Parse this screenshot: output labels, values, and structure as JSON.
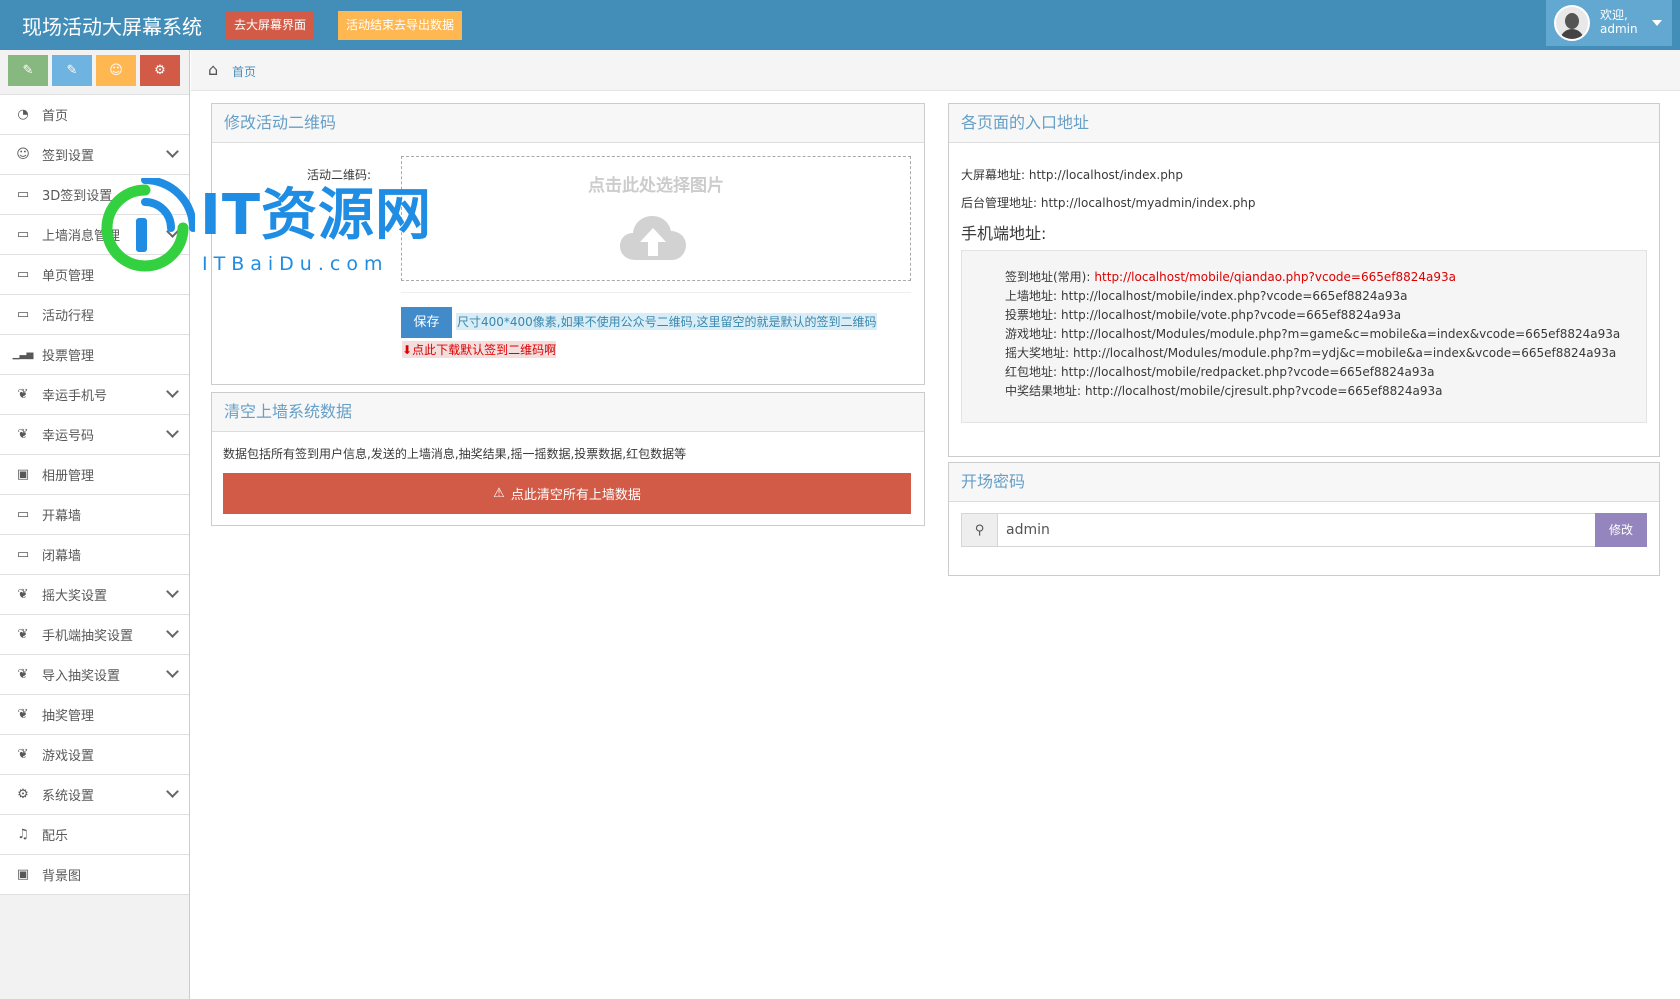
{
  "navbar": {
    "brand": "现场活动大屏幕系统",
    "btn_big_screen": "去大屏幕界面",
    "btn_export": "活动结束去导出数据",
    "welcome": "欢迎,",
    "username": "admin"
  },
  "colors": {
    "navbar": "#438eb9",
    "shortcut_green": "#87b87f",
    "shortcut_blue": "#6fb3e0",
    "shortcut_orange": "#ffb752",
    "shortcut_red": "#d15b47",
    "danger": "#d15b47",
    "primary": "#428bca",
    "purple": "#9585bf",
    "link_red": "#dd0000"
  },
  "sidebar": {
    "items": [
      {
        "label": "首页",
        "icon": "dashboard-icon",
        "has_submenu": false
      },
      {
        "label": "签到设置",
        "icon": "users-icon",
        "has_submenu": true
      },
      {
        "label": "3D签到设置",
        "icon": "desktop-icon",
        "has_submenu": false
      },
      {
        "label": "上墙消息管理",
        "icon": "desktop-icon",
        "has_submenu": true
      },
      {
        "label": "单页管理",
        "icon": "desktop-icon",
        "has_submenu": false
      },
      {
        "label": "活动行程",
        "icon": "desktop-icon",
        "has_submenu": false
      },
      {
        "label": "投票管理",
        "icon": "signal-icon",
        "has_submenu": false
      },
      {
        "label": "幸运手机号",
        "icon": "gift-icon",
        "has_submenu": true
      },
      {
        "label": "幸运号码",
        "icon": "gift-icon",
        "has_submenu": true
      },
      {
        "label": "相册管理",
        "icon": "picture-icon",
        "has_submenu": false
      },
      {
        "label": "开幕墙",
        "icon": "desktop-icon",
        "has_submenu": false
      },
      {
        "label": "闭幕墙",
        "icon": "desktop-icon",
        "has_submenu": false
      },
      {
        "label": "摇大奖设置",
        "icon": "gift-icon",
        "has_submenu": true
      },
      {
        "label": "手机端抽奖设置",
        "icon": "gift-icon",
        "has_submenu": true
      },
      {
        "label": "导入抽奖设置",
        "icon": "gift-icon",
        "has_submenu": true
      },
      {
        "label": "抽奖管理",
        "icon": "gift-icon",
        "has_submenu": false
      },
      {
        "label": "游戏设置",
        "icon": "gift-icon",
        "has_submenu": false
      },
      {
        "label": "系统设置",
        "icon": "cog-icon",
        "has_submenu": true
      },
      {
        "label": "配乐",
        "icon": "music-icon",
        "has_submenu": false
      },
      {
        "label": "背景图",
        "icon": "picture-icon",
        "has_submenu": false
      }
    ]
  },
  "breadcrumb": {
    "home": "首页"
  },
  "qrcode_widget": {
    "title": "修改活动二维码",
    "field_label": "活动二维码:",
    "dropzone_text": "点击此处选择图片",
    "save": "保存",
    "hint": "尺寸400*400像素,如果不使用公众号二维码,这里留空的就是默认的签到二维码",
    "download": "点此下载默认签到二维码啊"
  },
  "clear_widget": {
    "title": "清空上墙系统数据",
    "desc": "数据包括所有签到用户信息,发送的上墙消息,抽奖结果,摇一摇数据,投票数据,红包数据等",
    "button": "点此清空所有上墙数据"
  },
  "entry_widget": {
    "title": "各页面的入口地址",
    "big_screen_label": "大屏幕地址:",
    "big_screen_url": "http://localhost/index.php",
    "admin_label": "后台管理地址:",
    "admin_url": "http://localhost/myadmin/index.php",
    "mobile_heading": "手机端地址:",
    "mobile": [
      {
        "label": "签到地址(常用):",
        "url": "http://localhost/mobile/qiandao.php?vcode=665ef8824a93a"
      },
      {
        "label": "上墙地址:",
        "url": "http://localhost/mobile/index.php?vcode=665ef8824a93a"
      },
      {
        "label": "投票地址:",
        "url": "http://localhost/mobile/vote.php?vcode=665ef8824a93a"
      },
      {
        "label": "游戏地址:",
        "url": "http://localhost/Modules/module.php?m=game&c=mobile&a=index&vcode=665ef8824a93a"
      },
      {
        "label": "摇大奖地址:",
        "url": "http://localhost/Modules/module.php?m=ydj&c=mobile&a=index&vcode=665ef8824a93a"
      },
      {
        "label": "红包地址:",
        "url": "http://localhost/mobile/redpacket.php?vcode=665ef8824a93a"
      },
      {
        "label": "中奖结果地址:",
        "url": "http://localhost/mobile/cjresult.php?vcode=665ef8824a93a"
      }
    ]
  },
  "password_widget": {
    "title": "开场密码",
    "value": "admin",
    "button": "修改"
  },
  "watermark": {
    "text": "IT资源网",
    "sub": "ITBaiDu.com"
  }
}
